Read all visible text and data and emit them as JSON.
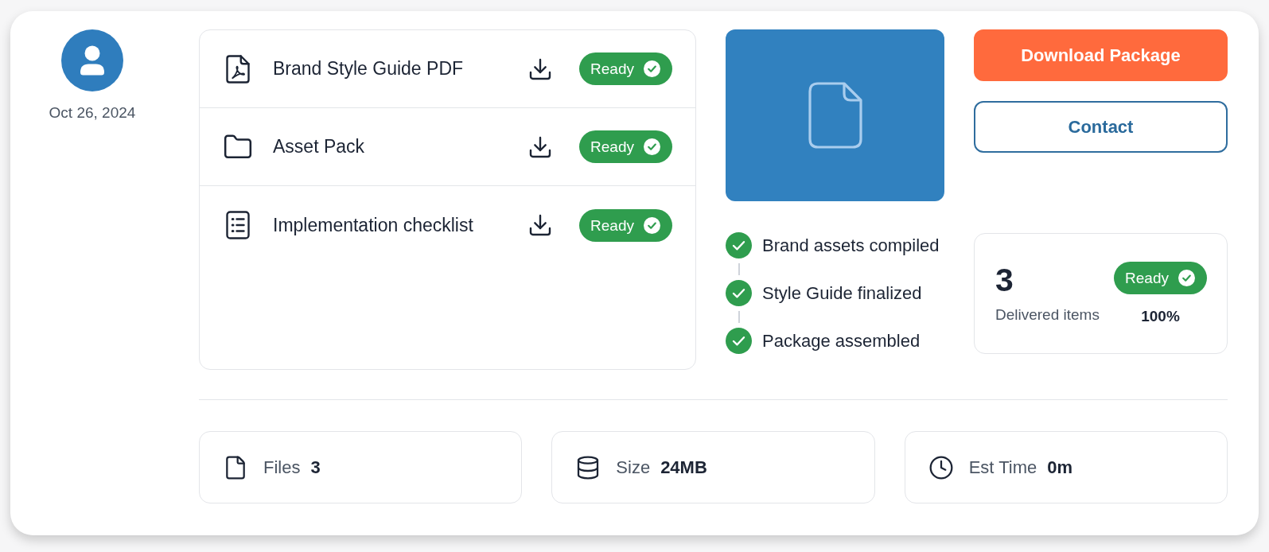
{
  "profile": {
    "date": "Oct 26, 2024"
  },
  "files": [
    {
      "kind": "pdf",
      "name": "Brand Style Guide PDF",
      "status": "Ready"
    },
    {
      "kind": "folder",
      "name": "Asset Pack",
      "status": "Ready"
    },
    {
      "kind": "checklist",
      "name": "Implementation checklist",
      "status": "Ready"
    }
  ],
  "steps": [
    {
      "label": "Brand assets compiled",
      "done": true
    },
    {
      "label": "Style Guide finalized",
      "done": true
    },
    {
      "label": "Package assembled",
      "done": true
    }
  ],
  "actions": [
    {
      "kind": "primary",
      "label": "Download Package"
    },
    {
      "kind": "outline",
      "label": "Contact"
    }
  ],
  "summary": {
    "count": "3",
    "label": "Delivered items",
    "status": "Ready",
    "percent": "100%"
  },
  "stats": [
    {
      "kind": "files",
      "label": "Files",
      "value": "3"
    },
    {
      "kind": "size",
      "label": "Size",
      "value": "24MB"
    },
    {
      "kind": "time",
      "label": "Est Time",
      "value": "0m"
    }
  ]
}
